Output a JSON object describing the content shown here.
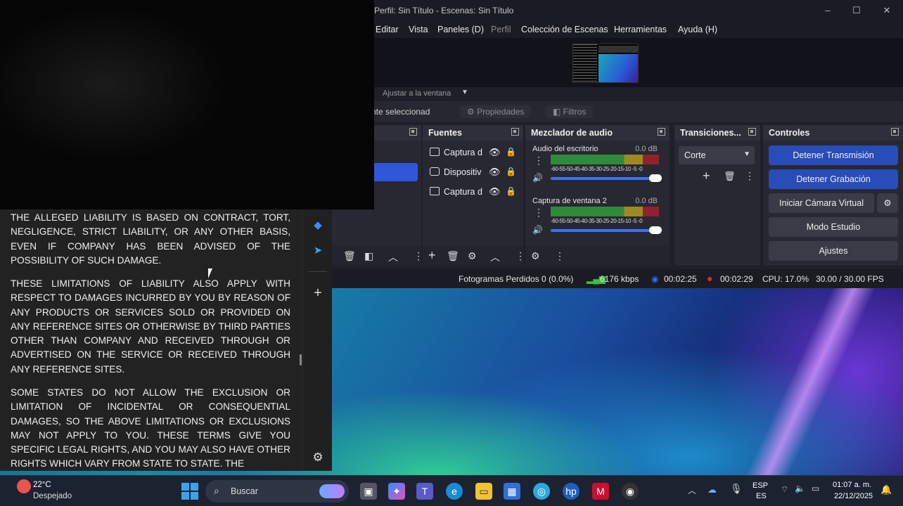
{
  "obs": {
    "title": "Perfil: Sin Título - Escenas: Sin Título",
    "menu": [
      "Editar",
      "Vista",
      "Paneles (D)",
      "Perfil",
      "Colección de Escenas",
      "Herramientas",
      "Ayuda (H)"
    ],
    "scale_label": "Ajustar a la ventana",
    "no_source_label": "nte seleccionad",
    "properties_btn": "Propiedades",
    "filters_btn": "Filtros",
    "docks": {
      "sources_title": "Fuentes",
      "mixer_title": "Mezclador de audio",
      "transitions_title": "Transiciones...",
      "controls_title": "Controles"
    },
    "sources": [
      {
        "label": "Captura d",
        "icon": "window-icon"
      },
      {
        "label": "Dispositiv",
        "icon": "camera-icon"
      },
      {
        "label": "Captura d",
        "icon": "monitor-icon"
      }
    ],
    "mixer": [
      {
        "name": "Audio del escritorio",
        "db": "0.0 dB"
      },
      {
        "name": "Captura de ventana 2",
        "db": "0.0 dB"
      }
    ],
    "mixer_ticks": "-60-55-50-45-40-35-30-25-20-15-10 -5 -0",
    "transition": "Corte",
    "controls": [
      "Detener Transmisión",
      "Detener Grabación",
      "Iniciar Cámara Virtual",
      "Modo Estudio",
      "Ajustes"
    ],
    "status": {
      "dropped": "Fotogramas Perdidos 0 (0.0%)",
      "bitrate": "6176 kbps",
      "stream_time": "00:02:25",
      "rec_time": "00:02:29",
      "cpu": "CPU: 17.0%",
      "fps": "30.00 / 30.00 FPS"
    },
    "colors": {
      "accent": "#284cb8",
      "record": "#e02a2a",
      "stream": "#2b6cff",
      "bitrate": "#3fbf3f"
    }
  },
  "document": {
    "paragraphs": [
      "THE ALLEGED LIABILITY IS BASED ON CONTRACT, TORT, NEGLIGENCE, STRICT LIABILITY, OR ANY OTHER BASIS, EVEN IF COMPANY HAS BEEN ADVISED OF THE POSSIBILITY OF SUCH DAMAGE.",
      "THESE LIMITATIONS OF LIABILITY ALSO APPLY WITH RESPECT TO DAMAGES INCURRED BY YOU BY REASON OF ANY PRODUCTS OR SERVICES SOLD OR PROVIDED ON ANY REFERENCE SITES OR OTHERWISE BY THIRD PARTIES OTHER THAN COMPANY AND RECEIVED THROUGH OR ADVERTISED ON THE SERVICE OR RECEIVED THROUGH ANY REFERENCE SITES.",
      "SOME STATES DO NOT ALLOW THE EXCLUSION OR LIMITATION OF INCIDENTAL OR CONSEQUENTIAL DAMAGES, SO THE ABOVE LIMITATIONS OR EXCLUSIONS MAY NOT APPLY TO YOU. THESE TERMS GIVE YOU SPECIFIC LEGAL RIGHTS, AND YOU MAY ALSO HAVE OTHER RIGHTS WHICH VARY FROM STATE TO STATE. THE"
    ]
  },
  "taskbar": {
    "weather_temp": "22°C",
    "weather_desc": "Despejado",
    "search_placeholder": "Buscar",
    "lang_top": "ESP",
    "lang_bottom": "ES",
    "time": "01:07 a. m.",
    "date": "22/12/2025"
  }
}
